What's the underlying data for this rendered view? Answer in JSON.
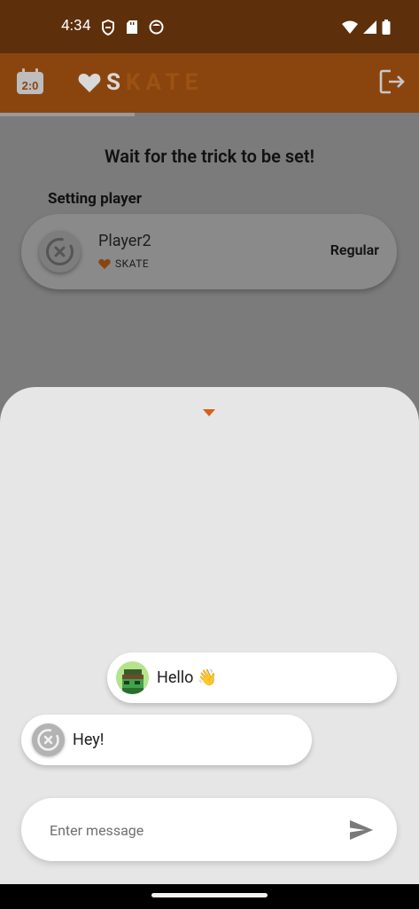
{
  "status_bar": {
    "time": "4:34"
  },
  "app_bar": {
    "logo_text_first": "S",
    "logo_text_rest": "KATE"
  },
  "main": {
    "title": "Wait for the trick to be set!",
    "section_label": "Setting player",
    "player": {
      "name": "Player2",
      "letters": "SKATE",
      "stance": "Regular"
    }
  },
  "chat": {
    "messages": [
      {
        "text": "Hello 👋",
        "direction": "incoming"
      },
      {
        "text": "Hey!",
        "direction": "outgoing"
      }
    ],
    "input": {
      "placeholder": "Enter message",
      "value": ""
    }
  },
  "colors": {
    "accent": "#d5601b",
    "status_bar": "#5d2f0b",
    "app_bar": "#8a450f",
    "sheet": "#e6e6e6"
  }
}
